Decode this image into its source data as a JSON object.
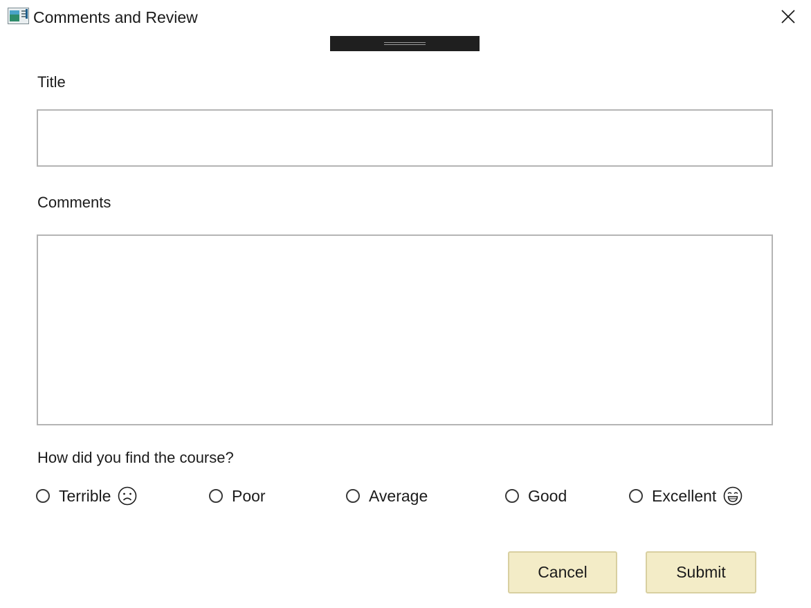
{
  "window": {
    "title": "Comments and Review",
    "app_icon": "form-app-icon",
    "close_icon": "close-icon"
  },
  "form": {
    "title_label": "Title",
    "title_value": "",
    "comments_label": "Comments",
    "comments_value": "",
    "question": "How did you find the course?"
  },
  "rating": {
    "options": [
      {
        "label": "Terrible",
        "icon": "sad-face-icon",
        "selected": false
      },
      {
        "label": "Poor",
        "selected": false
      },
      {
        "label": "Average",
        "selected": false
      },
      {
        "label": "Good",
        "selected": false
      },
      {
        "label": "Excellent",
        "icon": "grinning-face-icon",
        "selected": false
      }
    ]
  },
  "buttons": {
    "cancel": "Cancel",
    "submit": "Submit"
  },
  "colors": {
    "button_background": "#f3ecc7",
    "button_border": "#d8cfa0",
    "drag_handle": "#1f1f1f",
    "field_border": "#b4b4b4"
  }
}
